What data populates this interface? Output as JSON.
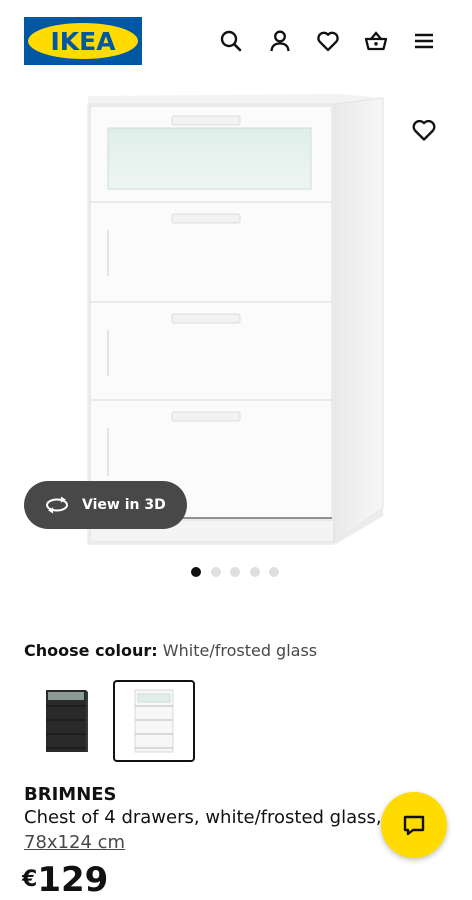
{
  "header": {
    "logo_text": "IKEA",
    "icons": [
      "search-icon",
      "user-icon",
      "heart-icon",
      "shopping-basket-icon",
      "menu-icon"
    ]
  },
  "gallery": {
    "view_3d_label": "View in 3D",
    "image_count": 5,
    "active_image": 1
  },
  "colour": {
    "label": "Choose colour:",
    "value": "White/frosted glass",
    "options": [
      "black",
      "white/frosted glass"
    ],
    "selected": "white/frosted glass"
  },
  "product": {
    "name": "BRIMNES",
    "description": "Chest of 4 drawers, white/frosted glass,",
    "size": "78x124 cm",
    "price_currency": "€",
    "price_amount": "129"
  },
  "colors": {
    "brand_blue": "#0058a3",
    "brand_yellow": "#ffdb00",
    "pill_gray": "#484848"
  }
}
